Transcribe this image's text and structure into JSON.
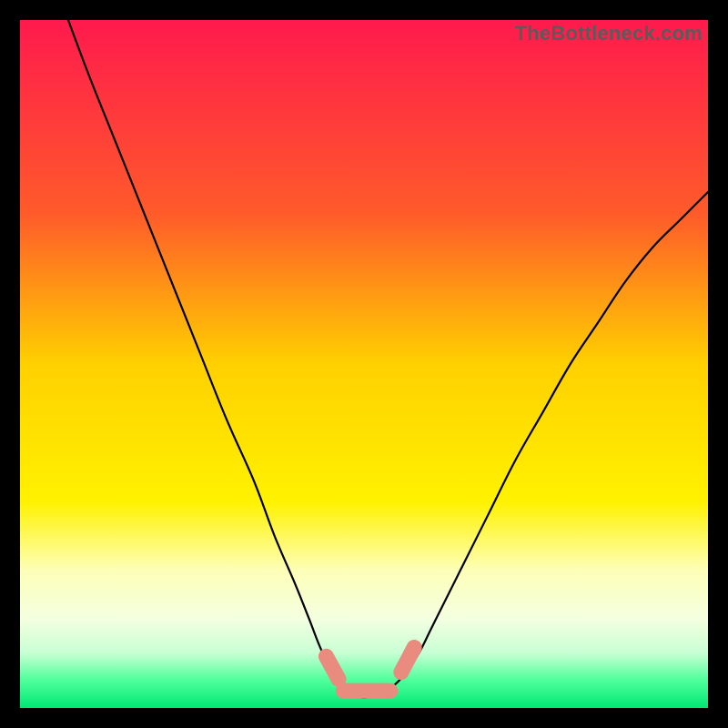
{
  "watermark": "TheBottleneck.com",
  "chart_data": {
    "type": "line",
    "title": "",
    "xlabel": "",
    "ylabel": "",
    "xlim": [
      0,
      100
    ],
    "ylim": [
      0,
      100
    ],
    "series": [
      {
        "name": "curve",
        "x": [
          7,
          10,
          14,
          18,
          22,
          26,
          30,
          34,
          37,
          40,
          42,
          44,
          46,
          47,
          48,
          50,
          52,
          54,
          56,
          58,
          60,
          64,
          68,
          72,
          76,
          80,
          84,
          88,
          92,
          96,
          100
        ],
        "y": [
          100,
          92,
          82,
          72,
          62,
          52,
          42,
          33,
          25,
          18,
          13,
          8,
          5,
          3,
          2,
          1.5,
          2,
          3,
          5,
          8,
          12,
          20,
          28,
          36,
          43,
          50,
          56,
          62,
          67,
          71,
          75
        ]
      }
    ],
    "markers": [
      {
        "name": "pill-left",
        "shape": "pill",
        "x1": 44.5,
        "y1": 7.5,
        "x2": 46.3,
        "y2": 4.2
      },
      {
        "name": "pill-mid",
        "shape": "pill",
        "x1": 47.0,
        "y1": 2.5,
        "x2": 53.8,
        "y2": 2.5
      },
      {
        "name": "pill-right",
        "shape": "pill",
        "x1": 55.4,
        "y1": 5.2,
        "x2": 57.3,
        "y2": 8.8
      }
    ],
    "gradient_stops": [
      {
        "offset": 0,
        "color": "#ff1a4d"
      },
      {
        "offset": 28,
        "color": "#ff5a2a"
      },
      {
        "offset": 50,
        "color": "#ffd000"
      },
      {
        "offset": 70,
        "color": "#fff200"
      },
      {
        "offset": 80,
        "color": "#fdffb8"
      },
      {
        "offset": 87,
        "color": "#f4ffe0"
      },
      {
        "offset": 92,
        "color": "#c8ffd4"
      },
      {
        "offset": 96,
        "color": "#4eff9a"
      },
      {
        "offset": 100,
        "color": "#00e874"
      }
    ]
  }
}
